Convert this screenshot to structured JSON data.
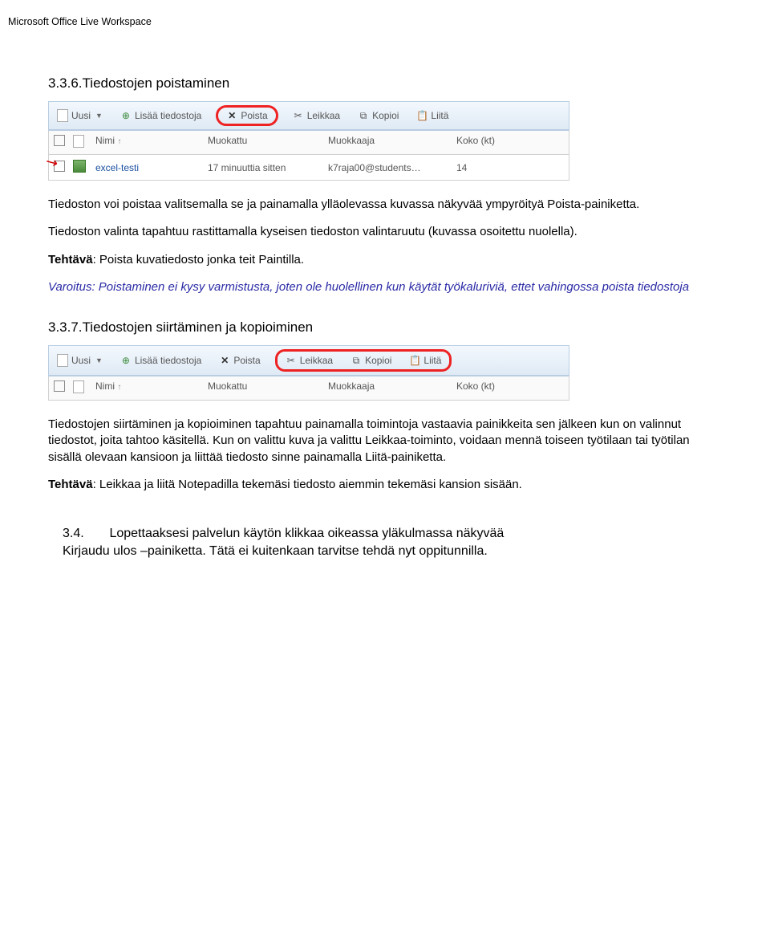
{
  "page_header": "Microsoft Office Live Workspace",
  "section336": {
    "heading": "3.3.6.Tiedostojen poistaminen",
    "para1": "Tiedoston voi poistaa valitsemalla se ja painamalla ylläolevassa kuvassa näkyvää ympyröityä Poista-painiketta.",
    "para2": "Tiedoston valinta tapahtuu rastittamalla kyseisen tiedoston valintaruutu (kuvassa osoitettu nuolella).",
    "task_label": "Tehtävä",
    "task_text": ": Poista kuvatiedosto jonka teit Paintilla.",
    "warning": "Varoitus: Poistaminen ei kysy varmistusta, joten ole huolellinen kun käytät työkaluriviä, ettet vahingossa poista tiedostoja"
  },
  "section337": {
    "heading": "3.3.7.Tiedostojen siirtäminen ja kopioiminen",
    "para1": "Tiedostojen siirtäminen ja kopioiminen tapahtuu painamalla toimintoja vastaavia painikkeita sen jälkeen kun on valinnut tiedostot, joita tahtoo käsitellä. Kun on valittu kuva ja valittu Leikkaa-toiminto, voidaan mennä toiseen työtilaan tai työtilan sisällä olevaan kansioon ja liittää tiedosto sinne painamalla Liitä-painiketta.",
    "task_label": "Tehtävä",
    "task_text": ": Leikkaa ja liitä Notepadilla tekemäsi tiedosto aiemmin tekemäsi kansion sisään."
  },
  "section34": {
    "num": "3.4.",
    "text1": "Lopettaaksesi palvelun käytön klikkaa oikeassa yläkulmassa näkyvää",
    "text2": "Kirjaudu ulos –painiketta. Tätä ei kuitenkaan tarvitse tehdä nyt oppitunnilla."
  },
  "toolbar": {
    "uusi": "Uusi",
    "lisaa": "Lisää tiedostoja",
    "poista": "Poista",
    "leikkaa": "Leikkaa",
    "kopioi": "Kopioi",
    "liita": "Liitä"
  },
  "table": {
    "cols": {
      "nimi": "Nimi",
      "muokattu": "Muokattu",
      "muokkaaja": "Muokkaaja",
      "koko": "Koko (kt)"
    },
    "row": {
      "name": "excel-testi",
      "modified": "17 minuuttia sitten",
      "editor": "k7raja00@students…",
      "size": "14"
    }
  }
}
